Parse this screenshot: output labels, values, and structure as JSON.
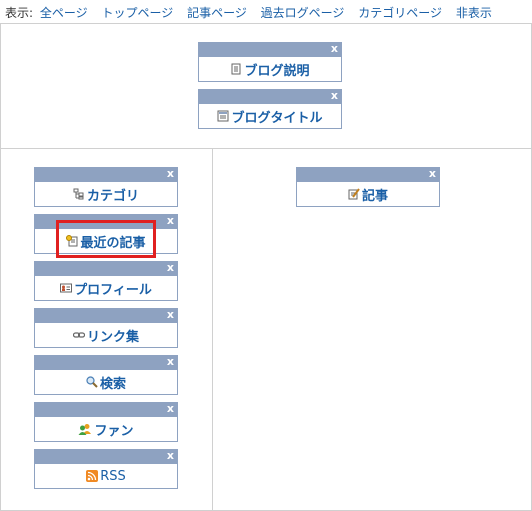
{
  "filter_bar": {
    "label": "表示:",
    "links": [
      "全ページ",
      "トップページ",
      "記事ページ",
      "過去ログページ",
      "カテゴリページ",
      "非表示"
    ]
  },
  "close_glyph": "x",
  "widgets": {
    "blog_description": "ブログ説明",
    "blog_title": "ブログタイトル",
    "category": "カテゴリ",
    "recent_articles": "最近の記事",
    "profile": "プロフィール",
    "link_collection": "リンク集",
    "search": "検索",
    "fan": "ファン",
    "rss": "RSS",
    "article": "記事"
  },
  "colors": {
    "widget_bar": "#8ea2c1",
    "link": "#1a5fa6",
    "highlight": "#e02020"
  },
  "icons": {
    "blog_description": "document-icon",
    "blog_title": "title-document-icon",
    "category": "category-tree-icon",
    "recent_articles": "recent-articles-icon",
    "profile": "profile-card-icon",
    "link_collection": "chain-link-icon",
    "search": "magnifier-icon",
    "fan": "fan-users-icon",
    "rss": "rss-icon",
    "article": "pencil-document-icon"
  }
}
